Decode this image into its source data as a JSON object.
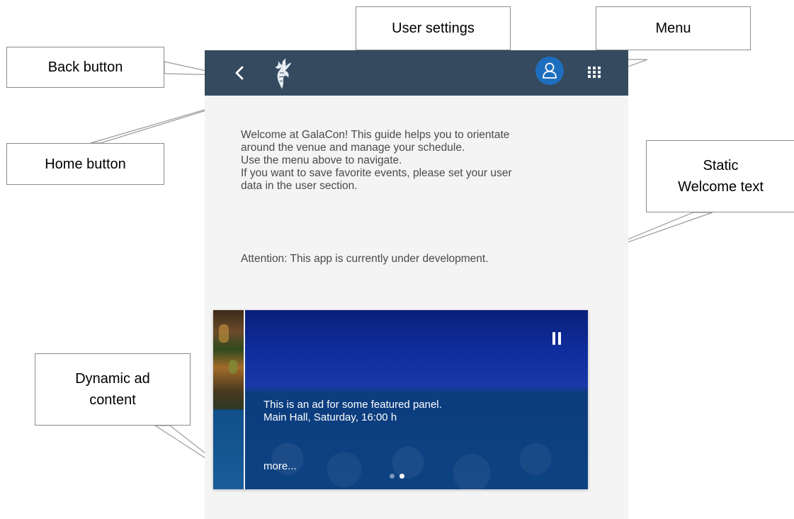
{
  "callouts": {
    "back": "Back button",
    "home": "Home button",
    "user_settings": "User settings",
    "menu": "Menu",
    "welcome_line1": "Static",
    "welcome_line2": "Welcome text",
    "ad_line1": "Dynamic ad",
    "ad_line2": "content"
  },
  "shellbar": {
    "back_icon": "chevron-left-icon",
    "logo_icon": "galacon-logo",
    "user_icon": "user-icon",
    "menu_icon": "grid-menu-icon",
    "background": "#354a5f",
    "user_button_color": "#1e6ebf"
  },
  "welcome": {
    "lines": [
      "Welcome at GalaCon! This guide helps you to orientate",
      "around the venue and manage your schedule.",
      "Use the menu above to navigate.",
      "If you want to save favorite events, please set your user",
      "data in the user section."
    ],
    "attention": "Attention: This app is currently under development."
  },
  "carousel": {
    "ad_line1": "This is an ad for some featured panel.",
    "ad_line2": "Main Hall, Saturday, 16:00 h",
    "more": "more...",
    "pause_icon": "pause-icon",
    "page_count": 2,
    "active_page": 2
  }
}
